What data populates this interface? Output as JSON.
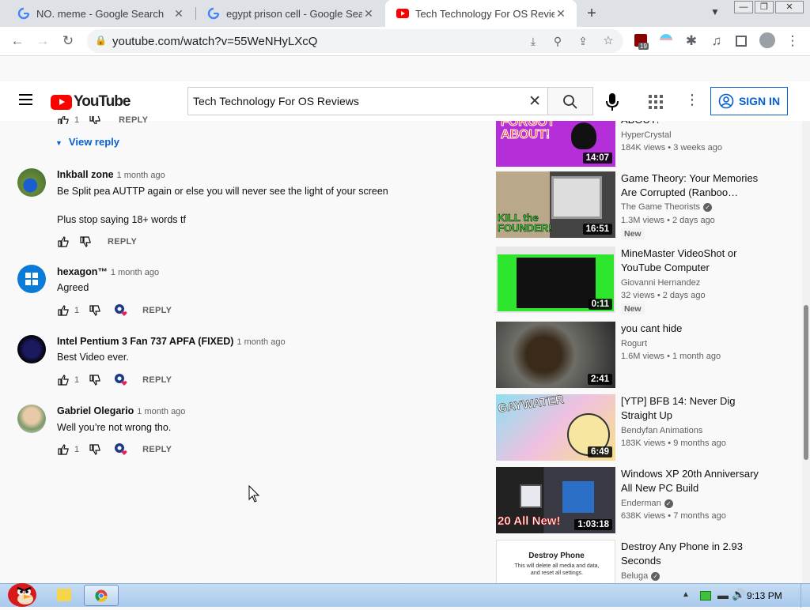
{
  "browser": {
    "tabs": [
      {
        "title": "NO. meme - Google Search",
        "icon": "google-icon"
      },
      {
        "title": "egypt prison cell - Google Sea",
        "icon": "google-icon"
      },
      {
        "title": "Tech Technology For OS Revie",
        "icon": "youtube-icon",
        "active": true
      }
    ],
    "url": "youtube.com/watch?v=55WeNHyLXcQ",
    "extension_badge": "19"
  },
  "youtube": {
    "logo_text": "YouTube",
    "search_value": "Tech Technology For OS Reviews",
    "signin_label": "SIGN IN"
  },
  "comments": {
    "top_reply_count": "1",
    "reply_label": "REPLY",
    "view_reply": "View reply",
    "items": [
      {
        "author": "Inkball zone",
        "time": "1 month ago",
        "lines": [
          "Be Split pea AUTTP again or else you will never see the light of your screen",
          "Plus stop saying 18+ words tf"
        ],
        "likes": "",
        "hearted": false
      },
      {
        "author": "hexagon™",
        "time": "1 month ago",
        "lines": [
          "Agreed"
        ],
        "likes": "1",
        "hearted": true
      },
      {
        "author": "Intel Pentium 3 Fan 737 APFA (FIXED)",
        "time": "1 month ago",
        "lines": [
          "Best Video ever."
        ],
        "likes": "1",
        "hearted": true
      },
      {
        "author": "Gabriel Olegario",
        "time": "1 month ago",
        "lines": [
          "Well you’re not wrong tho."
        ],
        "likes": "1",
        "hearted": true
      }
    ]
  },
  "recommendations": [
    {
      "title": "ABOUT!",
      "channel": "HyperCrystal",
      "meta": "184K views • 3 weeks ago",
      "duration": "14:07",
      "verified": false,
      "new": false,
      "thumb_text": "FORGOT ABOUT!"
    },
    {
      "title": "Game Theory: Your Memories Are Corrupted (Ranboo…",
      "channel": "The Game Theorists",
      "meta": "1.3M views • 2 days ago",
      "duration": "16:51",
      "verified": true,
      "new": true,
      "thumb_text": "KILL the FOUNDER!"
    },
    {
      "title": "MineMaster VideoShot or YouTube Computer",
      "channel": "Giovanni Hernandez",
      "meta": "32 views • 2 days ago",
      "duration": "0:11",
      "verified": false,
      "new": true,
      "thumb_text": ""
    },
    {
      "title": "you cant hide",
      "channel": "Rogurt",
      "meta": "1.6M views • 1 month ago",
      "duration": "2:41",
      "verified": false,
      "new": false,
      "thumb_text": ""
    },
    {
      "title": "[YTP] BFB 14: Never Dig Straight Up",
      "channel": "Bendyfan Animations",
      "meta": "183K views • 9 months ago",
      "duration": "6:49",
      "verified": false,
      "new": false,
      "thumb_text": "GAYWATER"
    },
    {
      "title": "Windows XP 20th Anniversary All New PC Build",
      "channel": "Enderman",
      "meta": "638K views • 7 months ago",
      "duration": "1:03:18",
      "verified": true,
      "new": false,
      "thumb_text": "20 All New!"
    },
    {
      "title": "Destroy Any Phone in 2.93 Seconds",
      "channel": "Beluga",
      "meta": "",
      "duration": "",
      "verified": true,
      "new": false,
      "thumb_text": "Destroy Phone",
      "thumb_sub": "This will delete all media and data, and reset all settings."
    }
  ],
  "new_badge": "New",
  "taskbar": {
    "time": "9:13 PM"
  },
  "colors": {
    "accent": "#065fd4",
    "yt_red": "#ff0000",
    "heart": "#e0245e"
  }
}
